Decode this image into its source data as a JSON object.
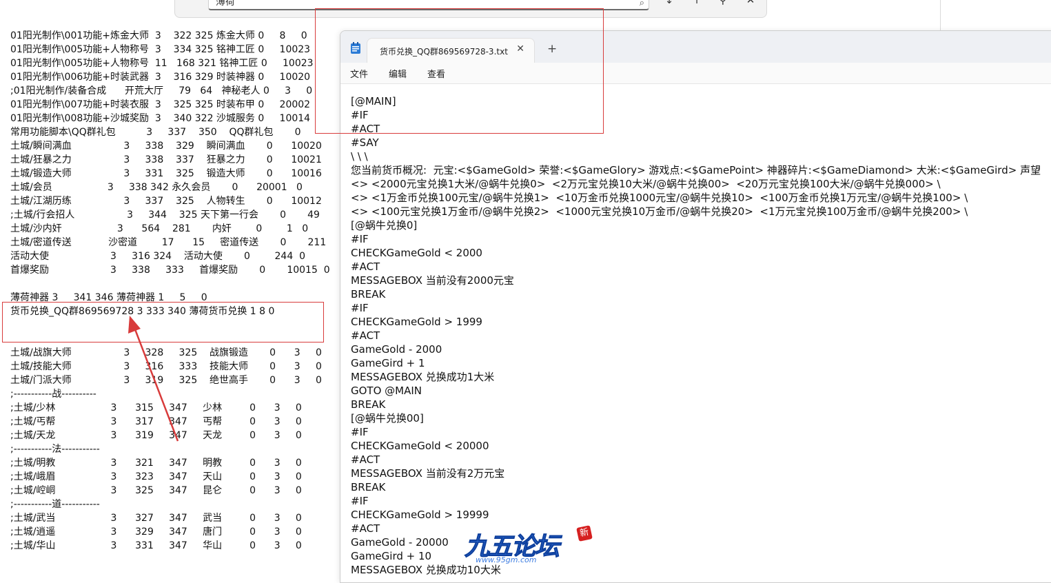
{
  "findbar": {
    "query": "薄荷",
    "btn_down": "↓",
    "btn_up": "↑",
    "btn_filter": "⚲",
    "btn_close": "✕"
  },
  "background_lines": [
    "01阳光制作\\001功能+炼金大师  3    322 325 炼金大师 0     8     0",
    "01阳光制作\\005功能+人物称号  3    334 325 铭神工匠 0     10023",
    "01阳光制作\\005功能+人物称号  11   168 321 铭神工匠 0     10023",
    "01阳光制作\\006功能+时装武器  3    316 329 时装神器 0     10020",
    ";01阳光制作/装备合成      开荒大厅     79   64   神秘老人 0     3     0",
    "01阳光制作\\007功能+时装衣服  3    325 325 时装布甲 0     20002",
    "01阳光制作\\008功能+沙城奖励  3    340 322 沙城服务 0     10014",
    "常用功能脚本\\QQ群礼包          3     337    350    QQ群礼包       0",
    "土城/瞬间满血                 3     338    329    瞬间满血       0      10020",
    "土城/狂暴之力                 3     338    337    狂暴之力       0      10021",
    "土城/锻造大师                 3     331    325    锻造大师       0      10016",
    "土城/会员                  3     338 342 永久会员       0      20001   0",
    "土城/江湖历练                 3     337    325    人物转生       0      10012",
    ";土城/行会招人                 3     344    325 天下第一行会       0       49",
    "土城/沙内奸                  3      564    281       内奸        0        1   0",
    "土城/密道传送            沙密道        17      15     密道传送       0       211",
    "活动大使                    3     316 324    活动大使       0        244  0",
    "首爆奖励                    3     338     333     首爆奖励       0       10015  0",
    "",
    "薄荷神器 3     341 346 薄荷神器 1     5     0",
    "货币兑换_QQ群869569728 3 333 340 薄荷货币兑换 1 8 0",
    "",
    "",
    "土城/战旗大师                 3     328     325    战旗锻造       0      3     0",
    "土城/技能大师                 3     316     333    技能大师       0      3     0",
    "土城/门派大师                 3     319     325    绝世高手       0      3     0",
    ";-----------战----------",
    ";土城/少林                  3      315     347     少林         0      3     0",
    ";土城/丐帮                  3      317     347     丐帮         0      3     0",
    ";土城/天龙                  3      319     347     天龙         0      3     0",
    ";-----------法-----------",
    ";土城/明教                  3      321     347     明教         0      3     0",
    ";土城/峨眉                  3      323     347     天山         0      3     0",
    ";土城/崆峒                  3      325     347     昆仑         0      3     0",
    ";-----------道-----------",
    ";土城/武当                  3      327     347     武当         0      3     0",
    ";土城/逍遥                  3      329     347     唐门         0      3     0",
    ";土城/华山                  3      331     347     华山         0      3     0"
  ],
  "notepad": {
    "tab_title": "货币兑换_QQ群869569728-3.txt",
    "close_glyph": "✕",
    "newtab_glyph": "+",
    "menu": [
      "文件",
      "编辑",
      "查看"
    ],
    "lines": [
      "[@MAIN]",
      "#IF",
      "#ACT",
      "#SAY",
      "\\ \\ \\",
      "您当前货币概况:  元宝:<$GameGold> 荣誉:<$GameGlory> 游戏点:<$GamePoint> 神器碎片:<$GameDiamond> 大米:<$GameGird> 声望",
      "<> <2000元宝兑换1大米/@蜗牛兑换0>  <2万元宝兑换10大米/@蜗牛兑换00>  <20万元宝兑换100大米/@蜗牛兑换000> \\",
      "<> <1万金币兑换100元宝/@蜗牛兑换1>  <10万金币兑换1000元宝/@蜗牛兑换10>  <100万金币兑换1万元宝/@蜗牛兑换100> \\",
      "<> <100元宝兑换1万金币/@蜗牛兑换2>  <1000元宝兑换10万金币/@蜗牛兑换20>  <1万元宝兑换100万金币/@蜗牛兑换200> \\",
      "[@蜗牛兑换0]",
      "#IF",
      "CHECKGameGold < 2000",
      "#ACT",
      "MESSAGEBOX 当前没有2000元宝",
      "BREAK",
      "#IF",
      "CHECKGameGold > 1999",
      "#ACT",
      "GameGold - 2000",
      "GameGird + 1",
      "MESSAGEBOX 兑换成功1大米",
      "GOTO @MAIN",
      "BREAK",
      "[@蜗牛兑换00]",
      "#IF",
      "CHECKGameGold < 20000",
      "#ACT",
      "MESSAGEBOX 当前没有2万元宝",
      "BREAK",
      "#IF",
      "CHECKGameGold > 19999",
      "#ACT",
      "GameGold - 20000",
      "GameGird + 10",
      "MESSAGEBOX 兑换成功10大米"
    ]
  },
  "watermark": {
    "title": "九五论坛",
    "badge": "新",
    "url": "www.95gm.com"
  },
  "colors": {
    "annotation_red": "#d83b3b",
    "watermark_blue": "#2f6fd8"
  }
}
